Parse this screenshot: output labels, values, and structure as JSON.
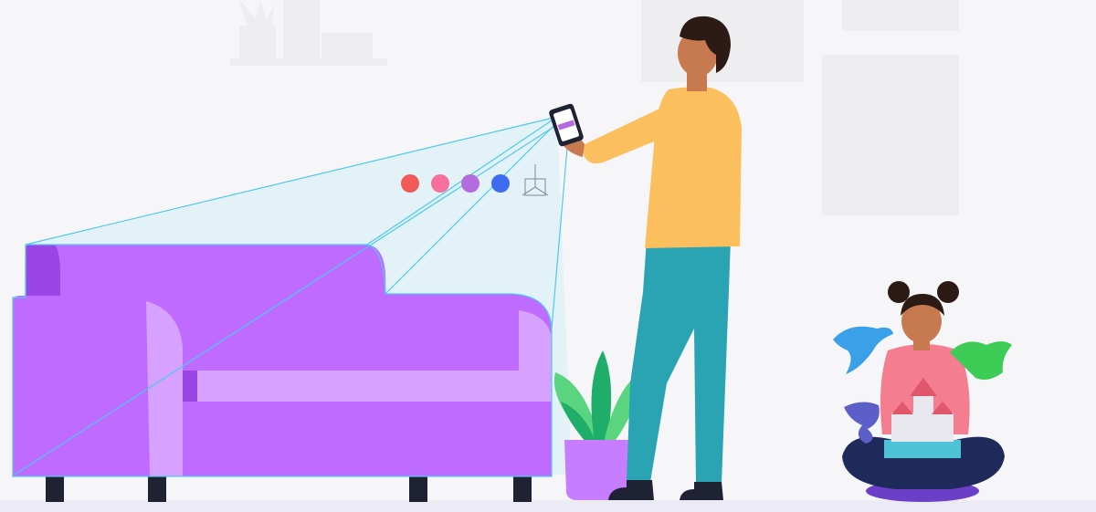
{
  "colors": {
    "background": "#f6f6f8",
    "wall_shapes": "#eeeef0",
    "floor": "#ecebf5",
    "sofa_main": "#bf6bff",
    "sofa_dark": "#9b45e6",
    "sofa_light": "#d7a2ff",
    "sofa_leg": "#1f2233",
    "scan_line": "#4cc9f0",
    "scan_fill": "#bfeaf7",
    "shirt": "#fbbf5e",
    "pants": "#2aa3b3",
    "skin": "#c77a4f",
    "hair": "#2b1b14",
    "shoes": "#1f2233",
    "pot": "#c77dff",
    "leaf_dark": "#1fae6a",
    "leaf_light": "#5ad47e",
    "girl_shirt": "#f47d8f",
    "girl_pants": "#1e2a5a",
    "cushion": "#6b3fc7",
    "castle_base": "#4ec3d6",
    "castle_wall": "#e8e8ee",
    "castle_roof": "#e0566b",
    "dragon_blue": "#3aa0e8",
    "dragon_green": "#3dcc55",
    "dragon_purple": "#5b5fc7"
  },
  "color_swatches": [
    {
      "name": "red",
      "color": "#f25a5a"
    },
    {
      "name": "pink",
      "color": "#f7709b"
    },
    {
      "name": "purple",
      "color": "#b46bde"
    },
    {
      "name": "blue",
      "color": "#3e6cf0"
    }
  ],
  "icons": {
    "cube": "cube-icon",
    "phone": "smartphone-icon"
  }
}
